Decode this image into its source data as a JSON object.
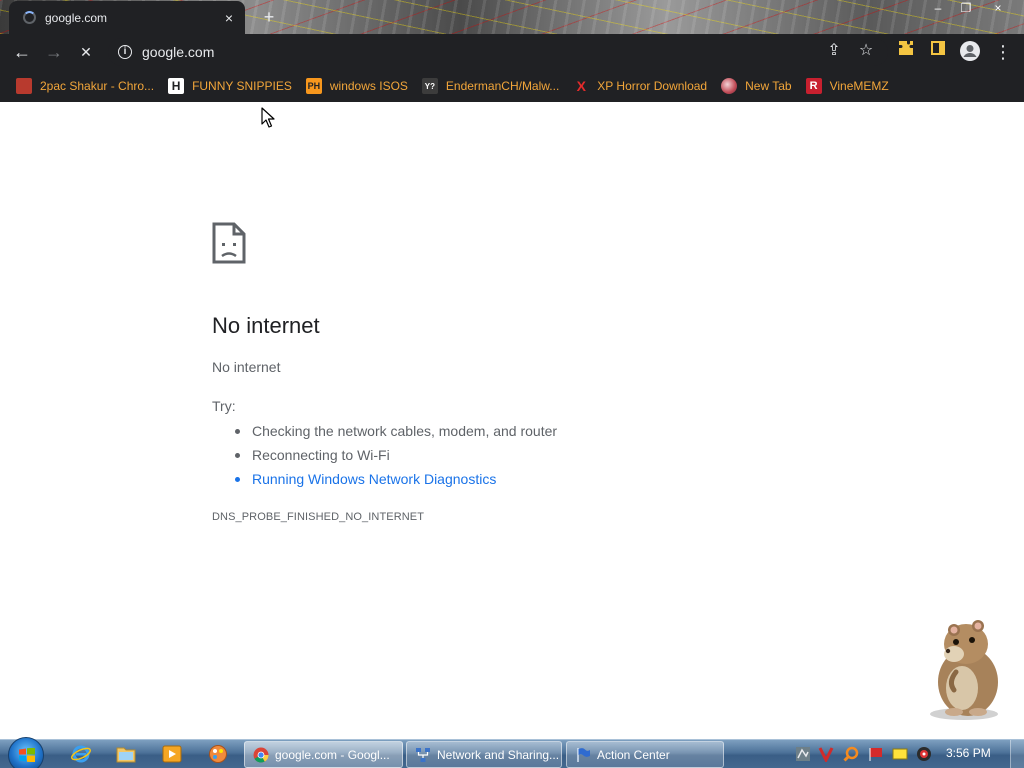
{
  "browser": {
    "tab": {
      "title": "google.com",
      "close_icon": "×"
    },
    "newtab_icon": "+",
    "window_controls": {
      "minimize": "–",
      "restore": "❐",
      "close": "×"
    },
    "nav": {
      "back": "←",
      "forward": "→",
      "stop": "✕"
    },
    "address": {
      "info_icon": "i",
      "url": "google.com"
    },
    "omnibox_icons": {
      "share": "⇪",
      "star": "☆"
    },
    "toolbar_icons": {
      "menu": "⋮"
    }
  },
  "bookmarks": [
    {
      "label": "2pac Shakur - Chro...",
      "icon": "2pac-icon",
      "color": "#b83a2e",
      "glyph": ""
    },
    {
      "label": "FUNNY SNIPPIES",
      "icon": "h-icon",
      "color": "#202124",
      "glyph": "H"
    },
    {
      "label": "windows ISOS",
      "icon": "ph-icon",
      "color": "#f7971d",
      "glyph": "PH"
    },
    {
      "label": "EndermanCH/Malw...",
      "icon": "yp-icon",
      "color": "#3c3c3c",
      "glyph": "Y?"
    },
    {
      "label": "XP Horror Download",
      "icon": "x-icon",
      "color": "#202124",
      "glyph": "X"
    },
    {
      "label": "New Tab",
      "icon": "globe-icon",
      "color": "#c04a55",
      "glyph": ""
    },
    {
      "label": "VineMEMZ",
      "icon": "r-icon",
      "color": "#c8202f",
      "glyph": "R"
    }
  ],
  "error_page": {
    "title": "No internet",
    "subtitle": "No internet",
    "try_label": "Try:",
    "suggestions": [
      "Checking the network cables, modem, and router",
      "Reconnecting to Wi-Fi",
      "Running Windows Network Diagnostics"
    ],
    "error_code": "DNS_PROBE_FINISHED_NO_INTERNET"
  },
  "taskbar": {
    "tasks": [
      {
        "label": "google.com - Googl...",
        "icon": "chrome-icon"
      },
      {
        "label": "Network and Sharing...",
        "icon": "network-icon"
      },
      {
        "label": "Action Center",
        "icon": "flag-icon"
      }
    ],
    "clock": "3:56 PM"
  },
  "colors": {
    "chrome_dark": "#202124",
    "bookmark_text": "#f2a63a",
    "link": "#1a73e8",
    "text_secondary": "#5f6368"
  }
}
